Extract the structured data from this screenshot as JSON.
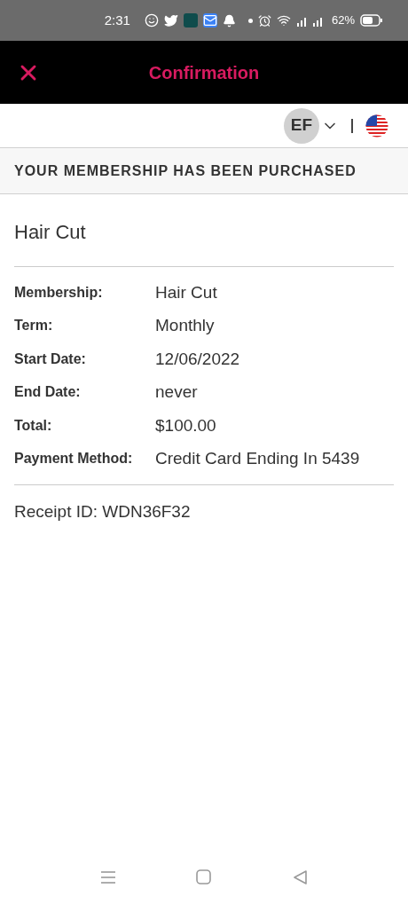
{
  "status_bar": {
    "time": "2:31",
    "battery": "62%"
  },
  "header": {
    "title": "Confirmation"
  },
  "account": {
    "initials": "EF"
  },
  "banner": "YOUR MEMBERSHIP HAS BEEN PURCHASED",
  "membership_title": "Hair Cut",
  "details": [
    {
      "label": "Membership:",
      "value": "Hair Cut"
    },
    {
      "label": "Term:",
      "value": "Monthly"
    },
    {
      "label": "Start Date:",
      "value": "12/06/2022"
    },
    {
      "label": "End Date:",
      "value": "never"
    },
    {
      "label": "Total:",
      "value": "$100.00"
    },
    {
      "label": "Payment Method:",
      "value": "Credit Card Ending In 5439"
    }
  ],
  "receipt": "Receipt ID: WDN36F32"
}
